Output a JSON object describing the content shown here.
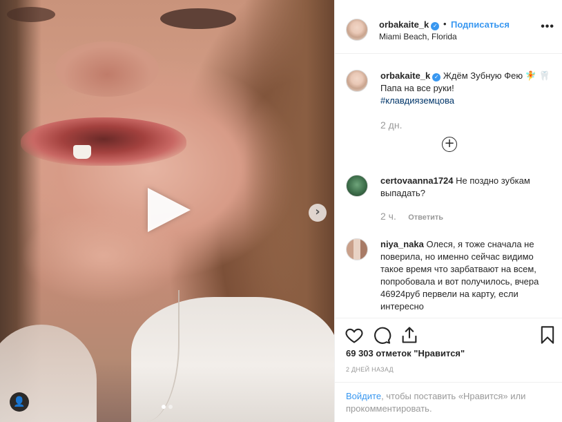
{
  "post": {
    "username": "orbakaite_k",
    "follow_separator": "•",
    "follow_label": "Подписаться",
    "location": "Miami Beach, Florida",
    "more_icon": "•••"
  },
  "media": {
    "next_icon": "›",
    "user_tag_icon": "👤",
    "carousel_index": 1,
    "carousel_count": 2
  },
  "caption": {
    "username": "orbakaite_k",
    "text": "Ждём Зубную Фею 🧚 🦷 Папа на все руки!",
    "hashtag": "#клавдияземцова",
    "time": "2 дн."
  },
  "load_more_icon": "+",
  "comments": [
    {
      "username": "certovaanna1724",
      "text": "Не поздно зубкам выпадать?",
      "time": "2 ч.",
      "reply_label": "Ответить"
    },
    {
      "username": "niya_naka",
      "text": "Олеся, я тоже сначала не поверила, но именно сейчас видимо такое время что зарбатвают на всем, попробовала и вот получилось, вчера 46924руб первели на карту, если интересно"
    }
  ],
  "likes_text": "69 303 отметок \"Нравится\"",
  "date_text": "2 ДНЕЙ НАЗАД",
  "footer": {
    "login_link": "Войдите",
    "rest": ", чтобы поставить «Нравится» или прокомментировать."
  },
  "verified_icon": "✓"
}
